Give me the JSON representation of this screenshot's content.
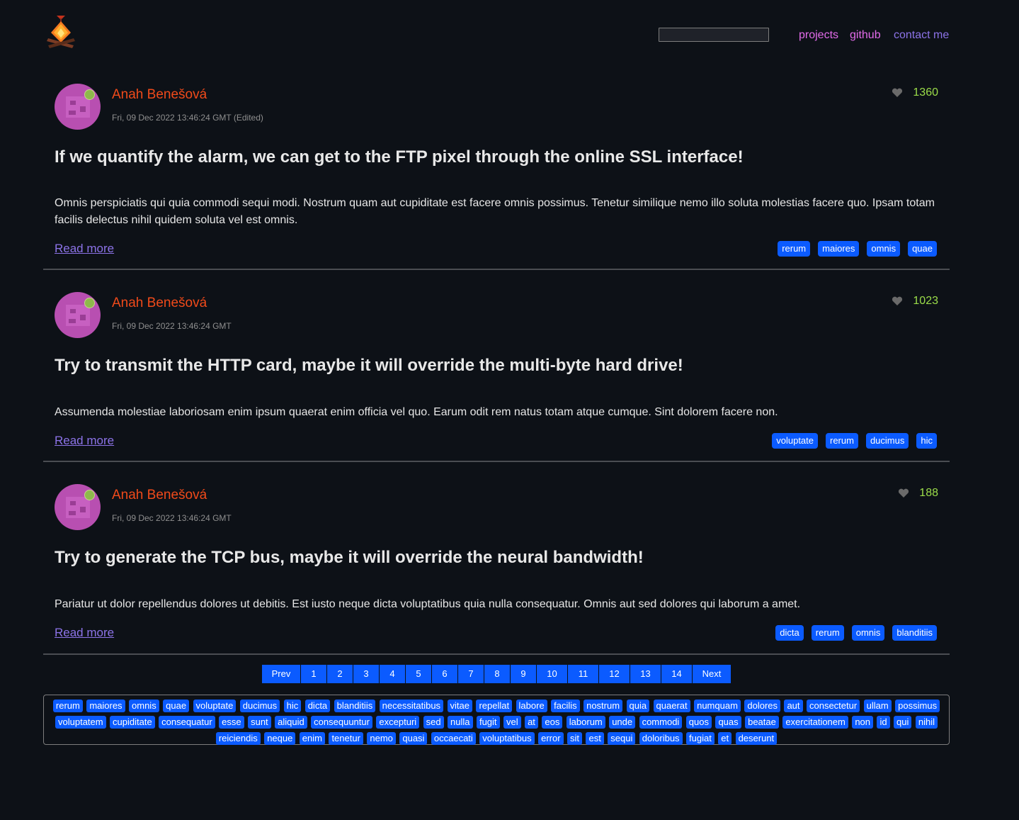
{
  "header": {
    "search_placeholder": "",
    "nav": {
      "projects": "projects",
      "github": "github",
      "contact": "contact me"
    }
  },
  "posts": [
    {
      "author": "Anah Benešová",
      "date": "Fri, 09 Dec 2022 13:46:24 GMT (Edited)",
      "likes": "1360",
      "title": "If we quantify the alarm, we can get to the FTP pixel through the online SSL interface!",
      "body": "Omnis perspiciatis qui quia commodi sequi modi. Nostrum quam aut cupiditate est facere omnis possimus. Tenetur similique nemo illo soluta molestias facere quo. Ipsam totam facilis delectus nihil quidem soluta vel est omnis.",
      "read_more": "Read more",
      "tags": [
        "rerum",
        "maiores",
        "omnis",
        "quae"
      ]
    },
    {
      "author": "Anah Benešová",
      "date": "Fri, 09 Dec 2022 13:46:24 GMT",
      "likes": "1023",
      "title": "Try to transmit the HTTP card, maybe it will override the multi-byte hard drive!",
      "body": "Assumenda molestiae laboriosam enim ipsum quaerat enim officia vel quo. Earum odit rem natus totam atque cumque. Sint dolorem facere non.",
      "read_more": "Read more",
      "tags": [
        "voluptate",
        "rerum",
        "ducimus",
        "hic"
      ]
    },
    {
      "author": "Anah Benešová",
      "date": "Fri, 09 Dec 2022 13:46:24 GMT",
      "likes": "188",
      "title": "Try to generate the TCP bus, maybe it will override the neural bandwidth!",
      "body": "Pariatur ut dolor repellendus dolores ut debitis. Est iusto neque dicta voluptatibus quia nulla consequatur. Omnis aut sed dolores qui laborum a amet.",
      "read_more": "Read more",
      "tags": [
        "dicta",
        "rerum",
        "omnis",
        "blanditiis"
      ]
    }
  ],
  "pagination": [
    "Prev",
    "1",
    "2",
    "3",
    "4",
    "5",
    "6",
    "7",
    "8",
    "9",
    "10",
    "11",
    "12",
    "13",
    "14",
    "Next"
  ],
  "tag_cloud": [
    "rerum",
    "maiores",
    "omnis",
    "quae",
    "voluptate",
    "ducimus",
    "hic",
    "dicta",
    "blanditiis",
    "necessitatibus",
    "vitae",
    "repellat",
    "labore",
    "facilis",
    "nostrum",
    "quia",
    "quaerat",
    "numquam",
    "dolores",
    "aut",
    "consectetur",
    "ullam",
    "possimus",
    "voluptatem",
    "cupiditate",
    "consequatur",
    "esse",
    "sunt",
    "aliquid",
    "consequuntur",
    "excepturi",
    "sed",
    "nulla",
    "fugit",
    "vel",
    "at",
    "eos",
    "laborum",
    "unde",
    "commodi",
    "quos",
    "quas",
    "beatae",
    "exercitationem",
    "non",
    "id",
    "qui",
    "nihil",
    "reiciendis",
    "neque",
    "enim",
    "tenetur",
    "nemo",
    "quasi",
    "occaecati",
    "voluptatibus",
    "error",
    "sit",
    "est",
    "sequi",
    "doloribus",
    "fugiat",
    "et",
    "deserunt"
  ],
  "colors": {
    "background": "#0d1117",
    "accent": "#0b5bff",
    "author": "#f04a1a",
    "likes": "#9bdd49",
    "link": "#8c73e8",
    "nav": "#e36bea"
  }
}
